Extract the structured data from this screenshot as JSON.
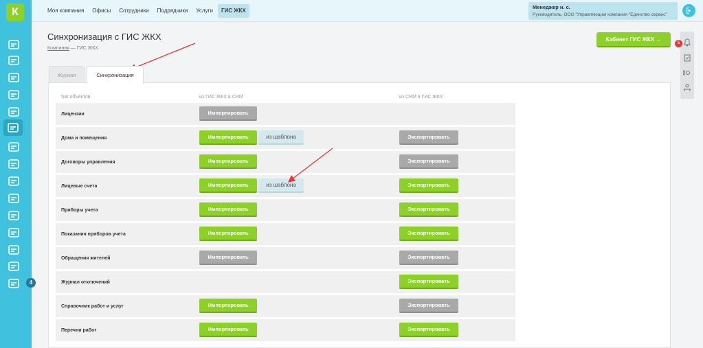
{
  "logo": {
    "letter": "К"
  },
  "nav": {
    "items": [
      {
        "label": "Моя компания",
        "active": false
      },
      {
        "label": "Офисы",
        "active": false
      },
      {
        "label": "Сотрудники",
        "active": false
      },
      {
        "label": "Подрядчики",
        "active": false
      },
      {
        "label": "Услуги",
        "active": false
      },
      {
        "label": "ГИС ЖКХ",
        "active": true
      }
    ]
  },
  "user": {
    "name": "Менеджер н. с.",
    "role": "Руководитель, ООО \"Управляющая компания \"Единство сервис\""
  },
  "sidebar": {
    "icons": [
      "chart-icon",
      "gauge-icon",
      "wallet-icon",
      "clipboard-icon",
      "users-icon",
      "flag-icon",
      "worker-icon",
      "box-icon",
      "coin-icon",
      "people-icon",
      "edit-icon",
      "building-icon",
      "smile-icon",
      "news-icon",
      "pin-icon"
    ],
    "active_index": 5,
    "badge": "4"
  },
  "rightrail": {
    "badge": "5",
    "icons": [
      "bell-icon",
      "clipboard-check-icon",
      "sound-icon",
      "worker-icon"
    ]
  },
  "page": {
    "title": "Синхронизация с ГИС ЖКХ",
    "breadcrumb_link": "Компания",
    "breadcrumb_rest": " — ГИС ЖКХ",
    "cabinet_button": "Кабинет ГИС ЖКХ →"
  },
  "tabs": {
    "journal": "Журнал",
    "sync": "Синхронизация"
  },
  "columns": {
    "type": "Тип объектов",
    "import": "из ГИС ЖКХ в CRM",
    "export": "из CRM в ГИС ЖКХ"
  },
  "buttons": {
    "import": "Импортировать",
    "export": "Экспортировать",
    "template": "из шаблона"
  },
  "rows": [
    {
      "label": "Лицензии",
      "import": "gray",
      "template": false,
      "export": null
    },
    {
      "label": "Дома и помещения",
      "import": "green",
      "template": true,
      "export": "gray"
    },
    {
      "label": "Договоры управления",
      "import": "green",
      "template": false,
      "export": "gray"
    },
    {
      "label": "Лицевые счета",
      "import": "green",
      "template": true,
      "export": "green"
    },
    {
      "label": "Приборы учета",
      "import": "green",
      "template": false,
      "export": "green"
    },
    {
      "label": "Показания приборов учета",
      "import": "green",
      "template": false,
      "export": "green"
    },
    {
      "label": "Обращения жителей",
      "import": "gray",
      "template": false,
      "export": "gray"
    },
    {
      "label": "Журнал отключений",
      "import": null,
      "template": false,
      "export": "green"
    },
    {
      "label": "Справочник работ и услуг",
      "import": "green",
      "template": false,
      "export": "gray"
    },
    {
      "label": "Перечни работ",
      "import": "green",
      "template": false,
      "export": "green"
    }
  ],
  "colors": {
    "sidebar": "#40c1dd",
    "accent_green": "#8ed02a",
    "disabled_gray": "#a9a9a9",
    "arrow_red": "#e53935"
  }
}
